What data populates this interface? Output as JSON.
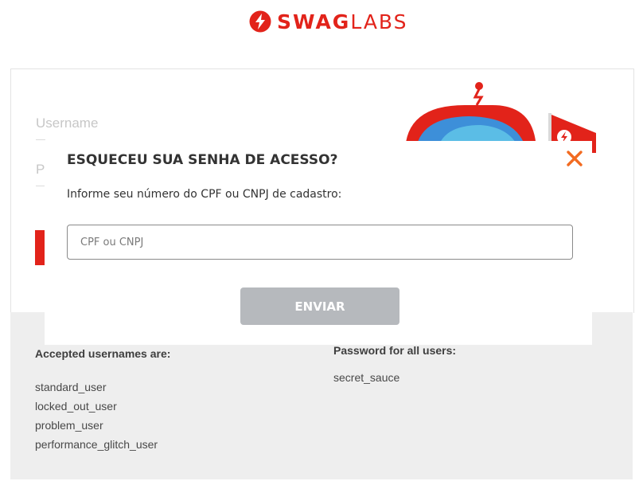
{
  "header": {
    "logo_bold": "SWAG",
    "logo_light": "LABS",
    "logo_icon": "swaglabs-logo-icon",
    "brand_color": "#e2231a"
  },
  "login": {
    "username_placeholder": "Username",
    "password_placeholder": "P"
  },
  "credentials": {
    "usernames_heading": "Accepted usernames are:",
    "usernames": [
      "standard_user",
      "locked_out_user",
      "problem_user",
      "performance_glitch_user"
    ],
    "password_heading": "Password for all users:",
    "password": "secret_sauce"
  },
  "modal": {
    "title": "ESQUECEU SUA SENHA DE ACESSO?",
    "description": "Informe seu número do CPF ou CNPJ de cadastro:",
    "input_placeholder": "CPF ou CNPJ",
    "input_value": "",
    "submit_label": "ENVIAR",
    "close_icon": "close-icon",
    "close_color": "#f26b21",
    "submit_color": "#b6b9bd"
  }
}
